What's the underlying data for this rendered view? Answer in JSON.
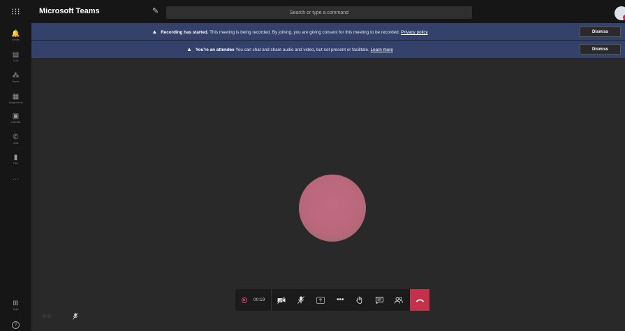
{
  "app": {
    "title": "Microsoft Teams"
  },
  "search": {
    "placeholder": "Search or type a command"
  },
  "rail": {
    "items": [
      {
        "icon": "bell-icon",
        "glyph": "🔔",
        "label": "Activity"
      },
      {
        "icon": "chat-icon",
        "glyph": "▤",
        "label": "Chat"
      },
      {
        "icon": "teams-icon",
        "glyph": "⁂",
        "label": "Teams"
      },
      {
        "icon": "assignments-icon",
        "glyph": "▦",
        "label": "Assignments"
      },
      {
        "icon": "calendar-icon",
        "glyph": "▣",
        "label": "Calendar"
      },
      {
        "icon": "calls-icon",
        "glyph": "✆",
        "label": "Calls"
      },
      {
        "icon": "files-icon",
        "glyph": "▮",
        "label": "Files"
      },
      {
        "icon": "more-icon",
        "glyph": "···",
        "label": ""
      }
    ],
    "bottom": [
      {
        "icon": "apps-icon",
        "glyph": "⊞",
        "label": "Apps"
      },
      {
        "icon": "help-icon",
        "glyph": "?",
        "label": ""
      }
    ]
  },
  "banners": [
    {
      "bold": "Recording has started.",
      "text": " This meeting is being recorded. By joining, you are giving consent for this meeting to be recorded. ",
      "link": "Privacy policy",
      "dismiss": "Dismiss"
    },
    {
      "bold": "You're an attendee",
      "text": " You can chat and share audio and video, but not present or facilitate. ",
      "link": "Learn more",
      "dismiss": "Dismiss"
    }
  ],
  "call": {
    "timer": "00:19",
    "controls": {
      "camera": "camera-off-icon",
      "mic": "mic-off-icon",
      "share": "share-icon",
      "more": "more-options-icon",
      "raise_hand": "raise-hand-icon",
      "chat": "chat-icon",
      "participants": "participants-icon",
      "hangup": "hang-up-icon"
    }
  },
  "colors": {
    "banner": "#34426b",
    "hangup": "#c4314b",
    "recording": "#d14a5f",
    "accent": "#6264a7"
  }
}
